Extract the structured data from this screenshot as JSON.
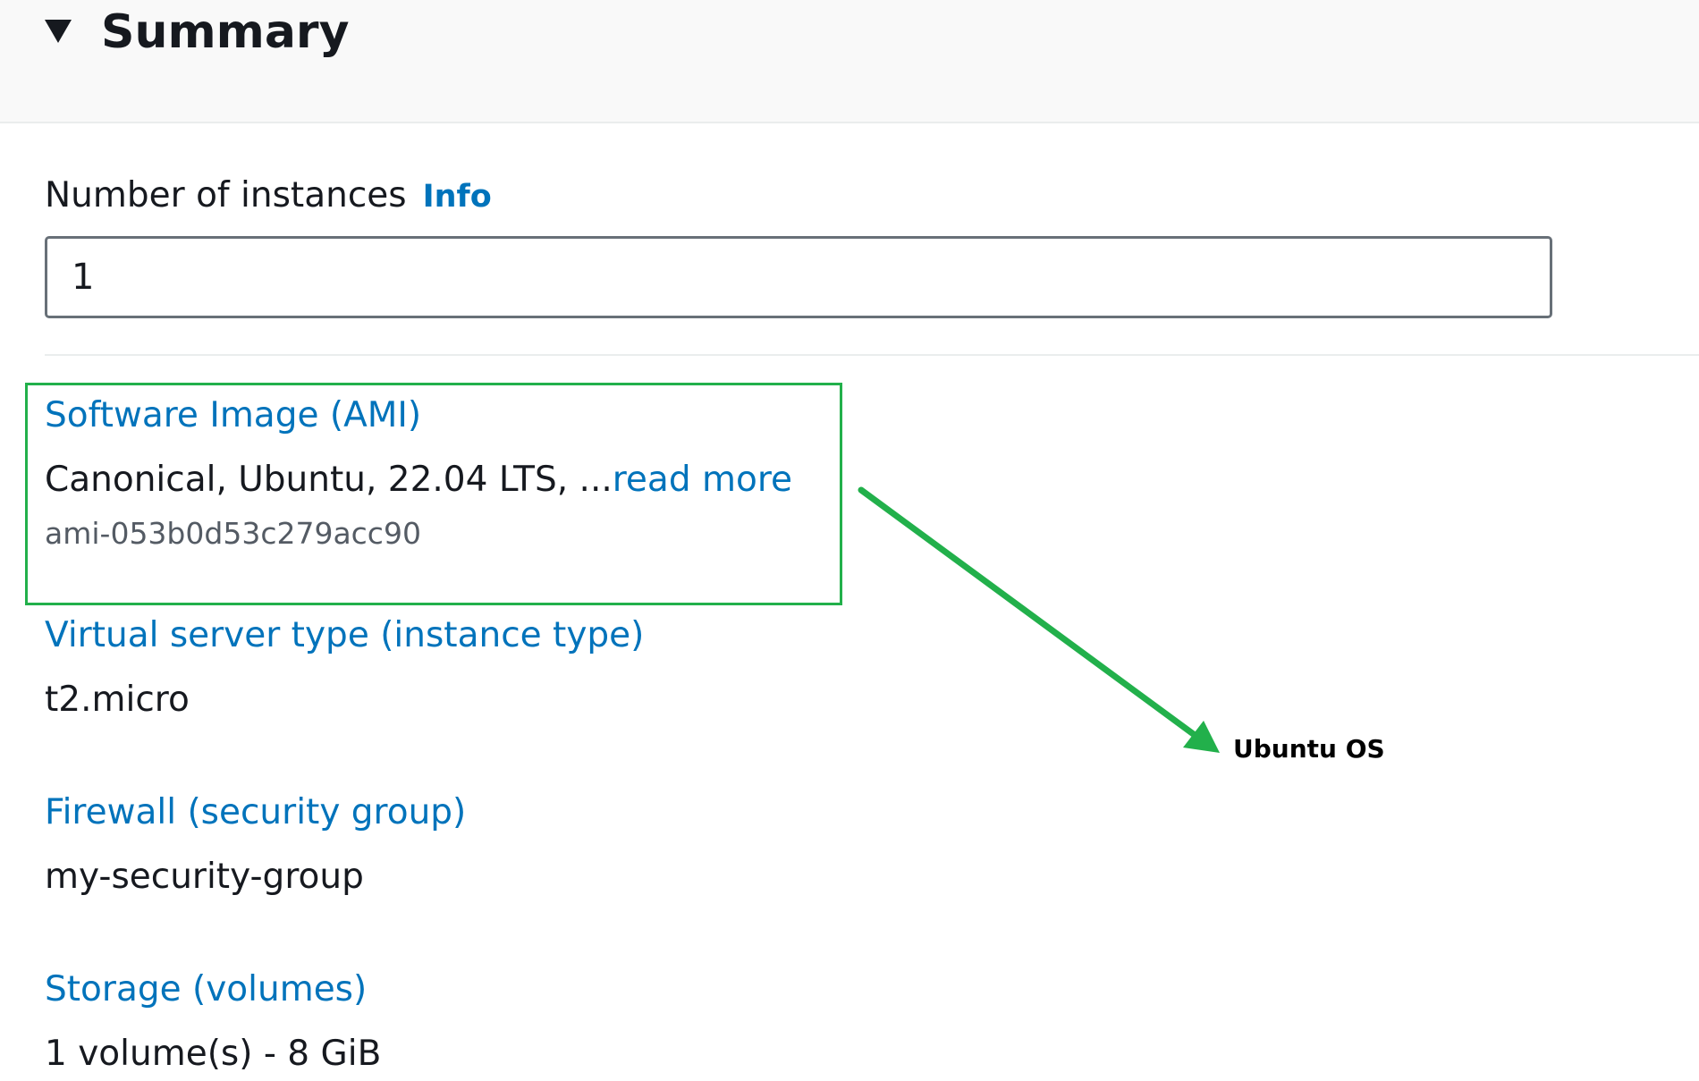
{
  "summary": {
    "title": "Summary",
    "expanded": true,
    "caret_icon": "caret-down-icon"
  },
  "instances": {
    "label": "Number of instances",
    "info_link": "Info",
    "value": "1"
  },
  "ami": {
    "label": "Software Image (AMI)",
    "value": "Canonical, Ubuntu, 22.04 LTS, ...",
    "read_more": "read more",
    "id": "ami-053b0d53c279acc90"
  },
  "instance_type": {
    "label": "Virtual server type (instance type)",
    "value": "t2.micro"
  },
  "firewall": {
    "label": "Firewall (security group)",
    "value": "my-security-group"
  },
  "storage": {
    "label": "Storage (volumes)",
    "value": "1 volume(s) - 8 GiB"
  },
  "annotation": {
    "text": "Ubuntu OS",
    "color": "#22b04b",
    "arrow_icon": "arrow-icon"
  },
  "colors": {
    "link": "#0073bb",
    "text": "#16191f",
    "muted": "#545b64",
    "highlight": "#22b04b",
    "header_bg": "#f9f9f9"
  }
}
